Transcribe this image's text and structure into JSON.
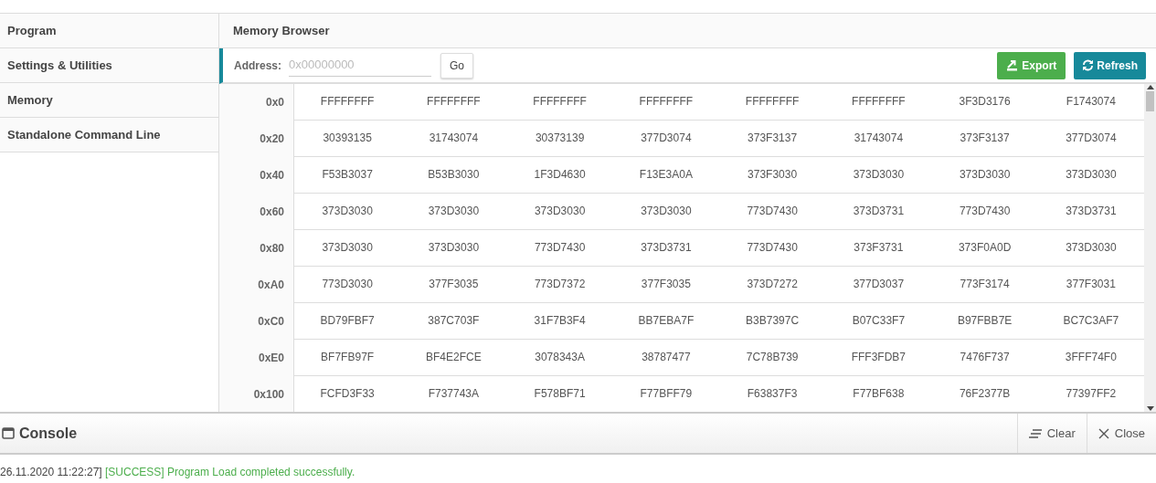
{
  "sidebar": {
    "items": [
      {
        "label": "Program"
      },
      {
        "label": "Settings & Utilities"
      },
      {
        "label": "Memory"
      },
      {
        "label": "Standalone Command Line"
      }
    ]
  },
  "memory_browser": {
    "title": "Memory Browser",
    "address_label": "Address:",
    "address_placeholder": "0x00000000",
    "go_button": "Go",
    "export_button": "Export",
    "refresh_button": "Refresh",
    "rows": [
      {
        "address": "0x0",
        "values": [
          "FFFFFFFF",
          "FFFFFFFF",
          "FFFFFFFF",
          "FFFFFFFF",
          "FFFFFFFF",
          "FFFFFFFF",
          "3F3D3176",
          "F1743074"
        ]
      },
      {
        "address": "0x20",
        "values": [
          "30393135",
          "31743074",
          "30373139",
          "377D3074",
          "373F3137",
          "31743074",
          "373F3137",
          "377D3074"
        ]
      },
      {
        "address": "0x40",
        "values": [
          "F53B3037",
          "B53B3030",
          "1F3D4630",
          "F13E3A0A",
          "373F3030",
          "373D3030",
          "373D3030",
          "373D3030"
        ]
      },
      {
        "address": "0x60",
        "values": [
          "373D3030",
          "373D3030",
          "373D3030",
          "373D3030",
          "773D7430",
          "373D3731",
          "773D7430",
          "373D3731"
        ]
      },
      {
        "address": "0x80",
        "values": [
          "373D3030",
          "373D3030",
          "773D7430",
          "373D3731",
          "773D7430",
          "373F3731",
          "373F0A0D",
          "373D3030"
        ]
      },
      {
        "address": "0xA0",
        "values": [
          "773D3030",
          "377F3035",
          "773D7372",
          "377F3035",
          "373D7272",
          "377D3037",
          "773F3174",
          "377F3031"
        ]
      },
      {
        "address": "0xC0",
        "values": [
          "BD79FBF7",
          "387C703F",
          "31F7B3F4",
          "BB7EBA7F",
          "B3B7397C",
          "B07C33F7",
          "B97FBB7E",
          "BC7C3AF7"
        ]
      },
      {
        "address": "0xE0",
        "values": [
          "BF7FB97F",
          "BF4E2FCE",
          "3078343A",
          "38787477",
          "7C78B739",
          "FFF3FDB7",
          "7476F737",
          "3FFF74F0"
        ]
      },
      {
        "address": "0x100",
        "values": [
          "FCFD3F33",
          "F737743A",
          "F578BF71",
          "F77BFF79",
          "F63837F3",
          "F77BF638",
          "76F2377B",
          "77397FF2"
        ]
      }
    ]
  },
  "console": {
    "title": "Console",
    "clear_button": "Clear",
    "close_button": "Close",
    "lines": [
      {
        "timestamp": "26.11.2020 11:22:27]",
        "message": "[SUCCESS] Program Load completed successfully.",
        "kind": "success"
      }
    ]
  }
}
